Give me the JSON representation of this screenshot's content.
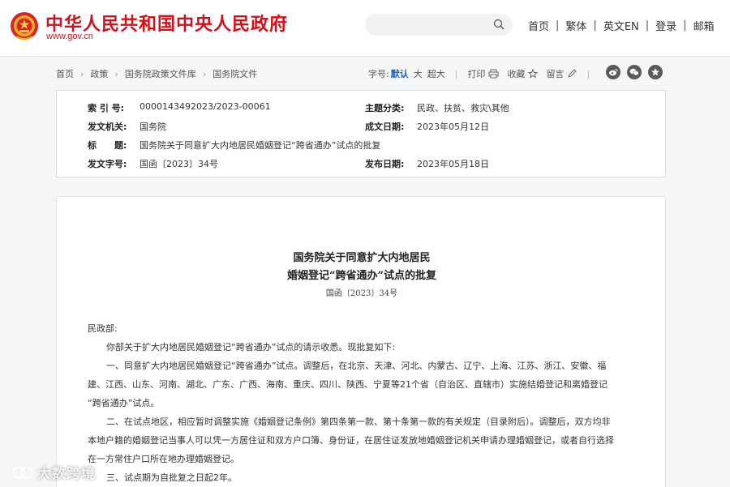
{
  "header": {
    "site_title": "中华人民共和国中央人民政府",
    "site_url": "www.gov.cn",
    "search_placeholder": "",
    "nav": [
      "首页",
      "繁体",
      "英文EN",
      "登录",
      "邮箱"
    ],
    "nav_sep": "|"
  },
  "breadcrumb": {
    "items": [
      "首页",
      "政策",
      "国务院政策文件库",
      "国务院文件"
    ],
    "arrow": "›"
  },
  "tools": {
    "font_label": "字号:",
    "font_default": "默认",
    "font_large": "大",
    "font_xlarge": "超大",
    "bar": "|",
    "print": "打印",
    "favorite": "收藏",
    "message": "留言"
  },
  "share": [
    "weibo-icon",
    "wechat-icon",
    "qzone-icon"
  ],
  "meta": {
    "index_label": "索 引 号:",
    "index_value": "000014349​2023/2023-00061",
    "topic_label": "主题分类:",
    "topic_value": "民政、扶贫、救灾\\其他",
    "issuer_label": "发文机关:",
    "issuer_value": "国务院",
    "date_label": "成文日期:",
    "date_value": "2023年05月12日",
    "title_label": "标　　题:",
    "title_value": "国务院关于同意扩大内地居民婚姻登记“跨省通办”试点的批复",
    "docno_label": "发文字号:",
    "docno_value": "国函〔2023〕34号",
    "pub_label": "发布日期:",
    "pub_value": "2023年05月18日"
  },
  "doc": {
    "title_line1": "国务院关于同意扩大内地居民",
    "title_line2": "婚姻登记“跨省通办”试点的批复",
    "doc_no": "国函〔2023〕34号",
    "addressee": "民政部:",
    "p1": "你部关于扩大内地居民婚姻登记“跨省通办”试点的请示收悉。现批复如下:",
    "p2a": "一、同意扩大内地居民婚姻登记“跨省通办”试点。调整后，在北京、天津、河北、内蒙古、辽宁、上海、江苏、浙江、安徽、福",
    "p2b": "建、江西、山东、河南、湖北、广东、广西、海南、重庆、四川、陕西、宁夏等21个省（自治区、直辖市）实施结婚登记和离婚登记",
    "p2c": "“跨省通办”试点。",
    "p3a": "二、在试点地区，相应暂时调整实施《婚姻登记条例》第四条第一款、第十条第一款的有关规定（目录附后）。调整后，双方均非",
    "p3b": "本地户籍的婚姻登记当事人可以凭一方居住证和双方户口簿、身份证，在居住证发放地婚姻登记机关申请办理婚姻登记，或者自行选择",
    "p3c": "在一方常住户口所在地办理婚姻登记。",
    "p4": "三、试点期为自批复之日起2年。"
  },
  "watermark": "大数跨境",
  "colors": {
    "brand_red": "#d0111b",
    "link_blue": "#1a63c9"
  }
}
